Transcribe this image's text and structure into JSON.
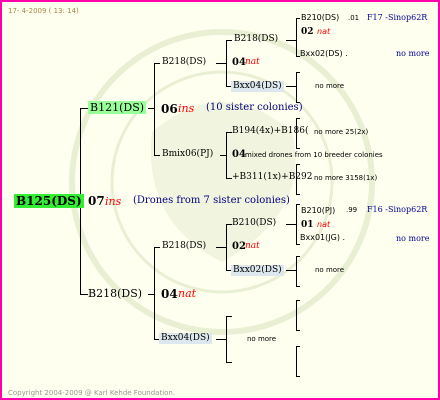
{
  "header": "17-  4-2009 ( 13: 14)",
  "footer": "Copyright 2004-2009 @ Karl Kehde Foundation.",
  "nomore": "no more",
  "root": {
    "name": "B125(DS)",
    "count": "07",
    "mating": "ins",
    "note": "(Drones from 7 sister colonies)"
  },
  "dam": {
    "name": "B121(DS)",
    "count": "06",
    "mating": "ins",
    "note": "(10 sister colonies)"
  },
  "sire": {
    "name": "B218(DS)",
    "count": "04",
    "mating": "nat"
  },
  "gen3": [
    "B218(DS)",
    "Bmix06(PJ)",
    "B218(DS)",
    "Bxx04(DS)"
  ],
  "b218a": {
    "count": "04",
    "mating": "nat"
  },
  "bmix": {
    "count": "04",
    "note": "mixed drones from 10 breeder colonies"
  },
  "b218b": {
    "count": "02",
    "mating": "nat"
  },
  "gen4": [
    "B218(DS)",
    "Bxx04(DS)",
    "B194(4x)+B186(",
    "+B311(1x)+B292",
    "B210(DS)",
    "Bxx02(DS)"
  ],
  "g5": {
    "b210a": "B210(DS)",
    "b210a_year": ".01",
    "f17": "F17 -Sinop62R",
    "count02": "02",
    "nat": "nat",
    "bxx02": "Bxx02(DS) .",
    "nomore25": "no more 25(2x)",
    "nomore3158": "no more 3158(1x)",
    "b210b": "B210(PJ)",
    "b210b_year": ".99",
    "f16": "F16 -Sinop62R",
    "count01": "01",
    "bxx01": "Bxx01(JG) ."
  }
}
